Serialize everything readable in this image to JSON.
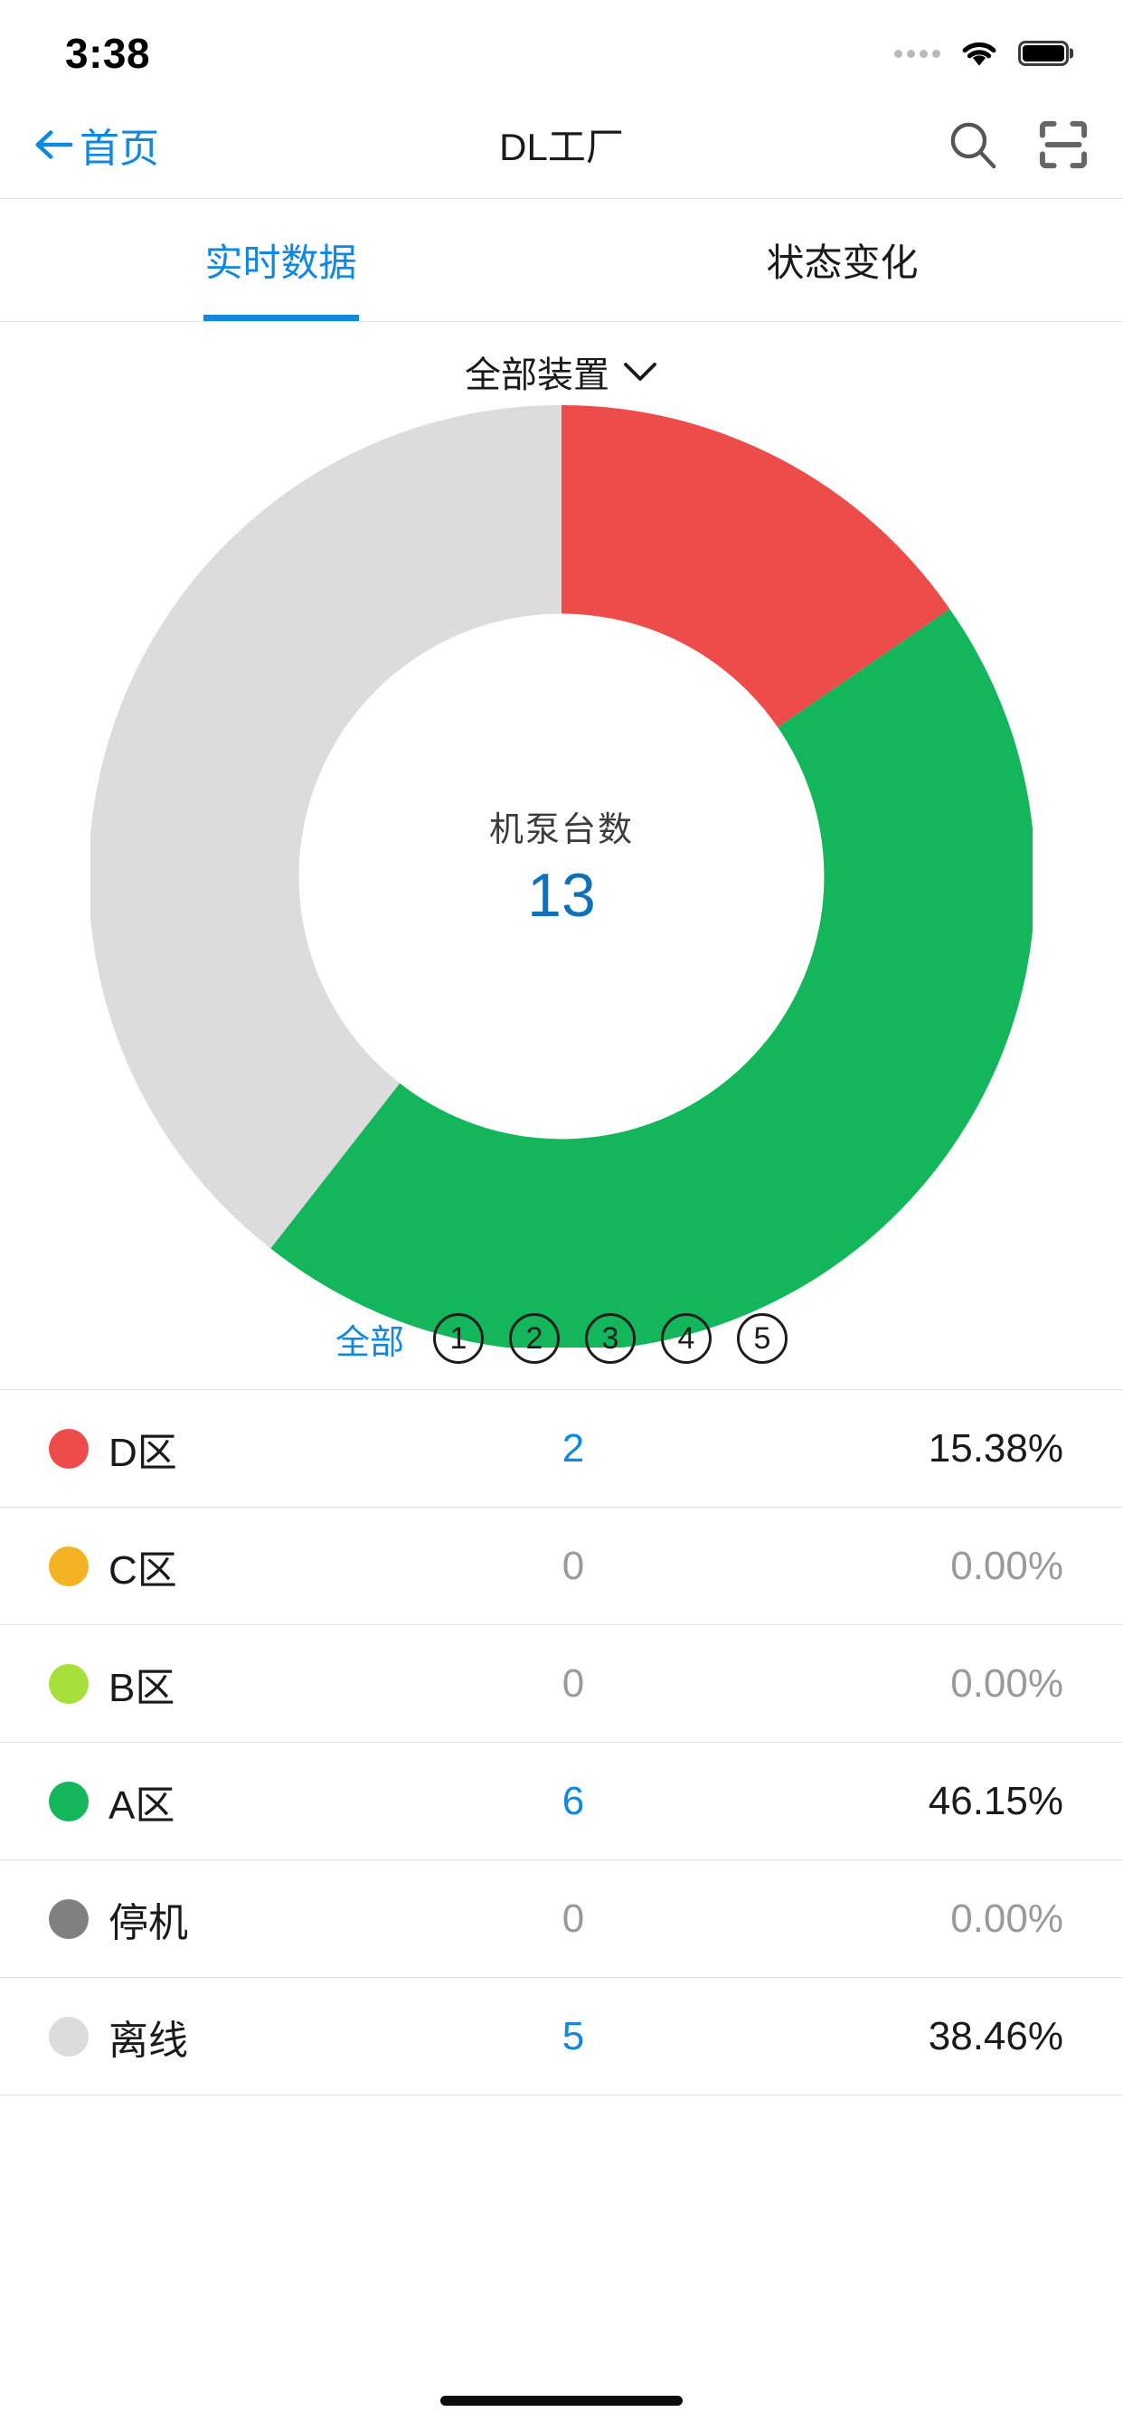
{
  "status_bar": {
    "time": "3:38",
    "signal_icon": "signal-dots-icon",
    "wifi_icon": "wifi-icon",
    "battery_icon": "battery-full-icon"
  },
  "nav": {
    "back_icon": "arrow-left-icon",
    "back_label": "首页",
    "title": "DL工厂",
    "search_icon": "search-icon",
    "scan_icon": "scan-qr-icon"
  },
  "tabs": [
    {
      "label": "实时数据",
      "active": true
    },
    {
      "label": "状态变化",
      "active": false
    }
  ],
  "selector": {
    "label": "全部装置",
    "chevron_icon": "chevron-down-icon"
  },
  "donut_center": {
    "label": "机泵台数",
    "value": "13"
  },
  "pager": {
    "all_label": "全部",
    "pages": [
      "1",
      "2",
      "3",
      "4",
      "5"
    ]
  },
  "legend": [
    {
      "name": "D区",
      "color": "#ee4c4b",
      "count": "2",
      "percent": "15.38%",
      "zero": false
    },
    {
      "name": "C区",
      "color": "#f5b222",
      "count": "0",
      "percent": "0.00%",
      "zero": true
    },
    {
      "name": "B区",
      "color": "#a7e03a",
      "count": "0",
      "percent": "0.00%",
      "zero": true
    },
    {
      "name": "A区",
      "color": "#13b65b",
      "count": "6",
      "percent": "46.15%",
      "zero": false
    },
    {
      "name": "停机",
      "color": "#808080",
      "count": "0",
      "percent": "0.00%",
      "zero": true
    },
    {
      "name": "离线",
      "color": "#dcdcdc",
      "count": "5",
      "percent": "38.46%",
      "zero": false
    }
  ],
  "chart_data": {
    "type": "pie",
    "variant": "donut",
    "title": "机泵台数",
    "center_value": 13,
    "total": 13,
    "start_angle_deg": 0,
    "direction": "clockwise",
    "inner_radius_ratio": 0.557,
    "legend_position": "below",
    "categories": [
      "D区",
      "C区",
      "B区",
      "A区",
      "停机",
      "离线"
    ],
    "values": [
      2,
      0,
      0,
      6,
      0,
      5
    ],
    "percents": [
      15.38,
      0.0,
      0.0,
      46.15,
      0.0,
      38.46
    ],
    "colors": [
      "#ee4c4b",
      "#f5b222",
      "#a7e03a",
      "#13b65b",
      "#808080",
      "#dcdcdc"
    ],
    "slices": [
      {
        "label": "D区",
        "value": 2,
        "percent": 15.38,
        "color": "#ee4c4b",
        "angle_deg": 55.4
      },
      {
        "label": "A区",
        "value": 6,
        "percent": 46.15,
        "color": "#13b65b",
        "angle_deg": 166.2
      },
      {
        "label": "离线",
        "value": 5,
        "percent": 38.46,
        "color": "#dcdcdc",
        "angle_deg": 138.5
      }
    ]
  },
  "theme": {
    "accent": "#1088e0",
    "text": "#1a1a1a",
    "muted": "#9a9a9a",
    "divider": "#e2e2e2"
  }
}
